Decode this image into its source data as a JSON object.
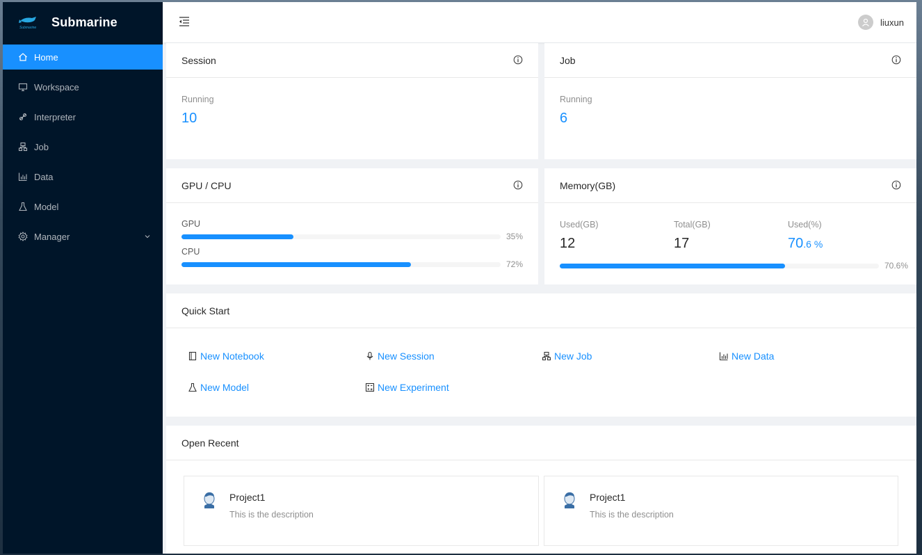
{
  "app": {
    "title": "Submarine",
    "logo_caption": "Submarine"
  },
  "sidebar": {
    "items": [
      {
        "label": "Home",
        "icon": "home-icon",
        "active": true
      },
      {
        "label": "Workspace",
        "icon": "desktop-icon"
      },
      {
        "label": "Interpreter",
        "icon": "api-icon"
      },
      {
        "label": "Job",
        "icon": "cluster-icon"
      },
      {
        "label": "Data",
        "icon": "bar-chart-icon"
      },
      {
        "label": "Model",
        "icon": "experiment-icon"
      },
      {
        "label": "Manager",
        "icon": "setting-icon",
        "has_submenu": true
      }
    ]
  },
  "header": {
    "username": "liuxun"
  },
  "session": {
    "title": "Session",
    "label": "Running",
    "value": "10"
  },
  "job": {
    "title": "Job",
    "label": "Running",
    "value": "6"
  },
  "gpu_cpu": {
    "title": "GPU / CPU",
    "bars": [
      {
        "label": "GPU",
        "percent": 35,
        "text": "35%"
      },
      {
        "label": "CPU",
        "percent": 72,
        "text": "72%"
      }
    ]
  },
  "memory": {
    "title": "Memory(GB)",
    "used_label": "Used(GB)",
    "used_value": "12",
    "total_label": "Total(GB)",
    "total_value": "17",
    "pct_label": "Used(%)",
    "pct_int": "70",
    "pct_frac": ".6 %",
    "bar_percent": 70.6,
    "bar_text": "70.6%"
  },
  "quick_start": {
    "title": "Quick Start",
    "links": [
      {
        "label": "New Notebook",
        "icon": "book-icon"
      },
      {
        "label": "New Session",
        "icon": "audio-icon"
      },
      {
        "label": "New Job",
        "icon": "cluster-icon"
      },
      {
        "label": "New Data",
        "icon": "bar-chart-icon"
      },
      {
        "label": "New Model",
        "icon": "experiment-icon"
      },
      {
        "label": "New Experiment",
        "icon": "calculator-icon"
      }
    ]
  },
  "open_recent": {
    "title": "Open Recent",
    "projects": [
      {
        "title": "Project1",
        "description": "This is the description"
      },
      {
        "title": "Project1",
        "description": "This is the description"
      }
    ]
  },
  "colors": {
    "primary": "#1890ff",
    "sidebar_bg": "#001529"
  }
}
